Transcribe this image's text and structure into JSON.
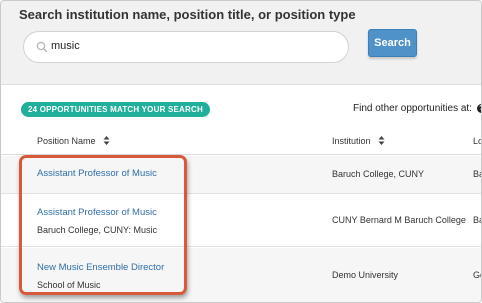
{
  "search": {
    "heading": "Search institution name, position title, or position type",
    "value": "music",
    "button_label": "Search"
  },
  "results": {
    "badge": "24 OPPORTUNITIES MATCH YOUR SEARCH",
    "find_other": "Find other opportunities at:"
  },
  "table": {
    "headers": {
      "position": "Position Name",
      "institution": "Institution",
      "location": "Lo"
    },
    "rows": [
      {
        "title": "Assistant Professor of Music",
        "subtitle": "",
        "institution": "Baruch College, CUNY",
        "location": "Ba"
      },
      {
        "title": "Assistant Professor of Music",
        "subtitle": "Baruch College, CUNY: Music",
        "institution": "CUNY Bernard M Baruch College",
        "location": "Ba"
      },
      {
        "title": "New Music Ensemble Director",
        "subtitle": "School of Music",
        "institution": "Demo University",
        "location": "Ge"
      }
    ]
  },
  "colors": {
    "accent_blue": "#4f91c9",
    "link_blue": "#2f6fa6",
    "badge_teal": "#1faf9a",
    "highlight_red": "#d9593b"
  },
  "icons": {
    "search": "search-icon",
    "sort": "sort-icon",
    "help": "help-icon"
  }
}
